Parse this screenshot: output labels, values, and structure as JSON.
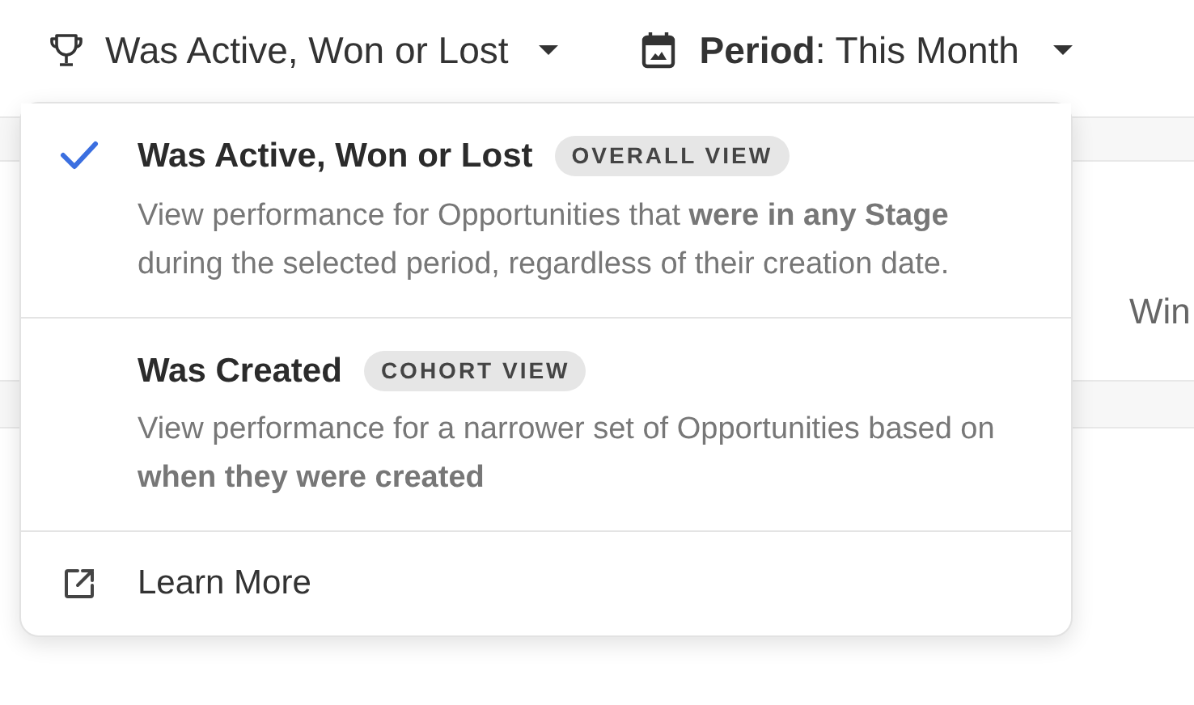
{
  "toolbar": {
    "filter": {
      "label": "Was Active, Won or Lost"
    },
    "period": {
      "text": "**Period**: This Month"
    }
  },
  "background": {
    "column_text": "Win"
  },
  "menu": {
    "options": [
      {
        "title": "Was Active, Won or Lost",
        "badge": "OVERALL VIEW",
        "selected": true,
        "description": "View performance for Opportunities that **were in any Stage** during the selected period, regardless of their creation date."
      },
      {
        "title": "Was Created",
        "badge": "COHORT VIEW",
        "selected": false,
        "description": "View performance for a narrower set of Opportunities based on **when they were created**"
      }
    ],
    "link": {
      "label": "Learn More"
    }
  }
}
